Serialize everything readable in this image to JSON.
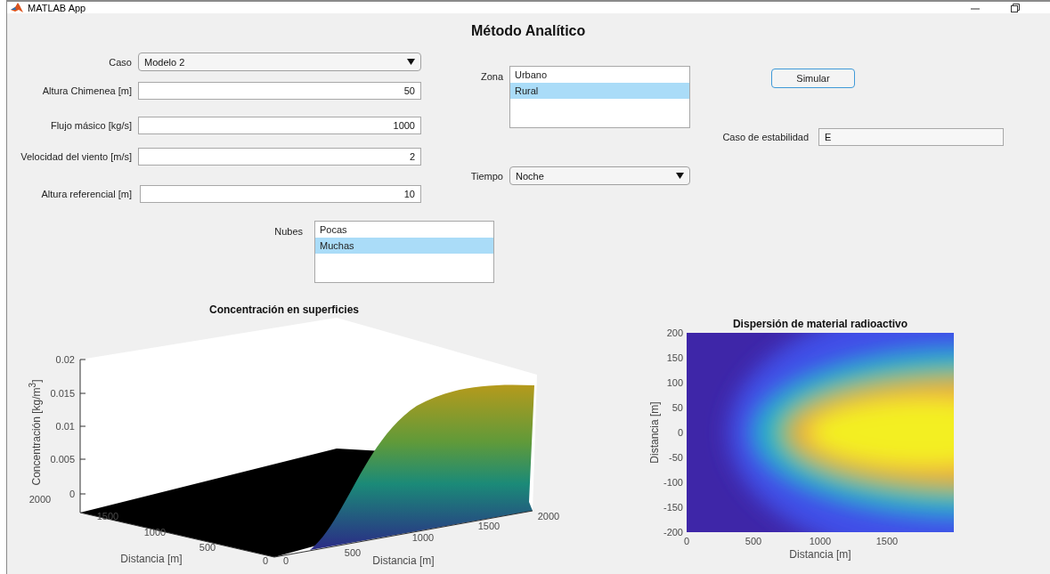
{
  "window": {
    "title": "MATLAB App"
  },
  "heading": "Método Analítico",
  "fields": [
    {
      "kind": "dropdown",
      "label": "Caso",
      "value": "Modelo 2"
    },
    {
      "kind": "number",
      "label": "Altura Chimenea [m]",
      "value": "50"
    },
    {
      "kind": "number",
      "label": "Flujo másico [kg/s]",
      "value": "1000"
    },
    {
      "kind": "number",
      "label": "Velocidad del viento [m/s]",
      "value": "2"
    },
    {
      "kind": "number",
      "label": "Altura referencial [m]",
      "value": "10"
    }
  ],
  "zona": {
    "label": "Zona",
    "items": [
      {
        "label": "Urbano",
        "selected": false
      },
      {
        "label": "Rural",
        "selected": true
      }
    ]
  },
  "tiempo": {
    "label": "Tiempo",
    "value": "Noche"
  },
  "nubes": {
    "label": "Nubes",
    "items": [
      {
        "label": "Pocas",
        "selected": false
      },
      {
        "label": "Muchas",
        "selected": true
      }
    ]
  },
  "simulate_button": "Simular",
  "estabilidad": {
    "label": "Caso de estabilidad",
    "value": "E"
  },
  "surface_plot": {
    "title": "Concentración en superficies",
    "zlabel": "Concentración  [kg/m$^{3}$]",
    "zticks": [
      "0.02",
      "0.015",
      "0.01",
      "0.005",
      "0"
    ],
    "left_axis": {
      "label": "Distancia [m]",
      "ticks": [
        "2000",
        "1500",
        "1000",
        "500",
        "0"
      ]
    },
    "right_axis": {
      "label": "Distancia [m]",
      "ticks": [
        "0",
        "500",
        "1000",
        "1500",
        "2000"
      ]
    }
  },
  "heatmap": {
    "title": "Dispersión de material radioactivo",
    "xlabel": "Distancia [m]",
    "ylabel": "Distancia [m]",
    "xticks": [
      "0",
      "500",
      "1000",
      "1500"
    ],
    "yticks": [
      "200",
      "150",
      "100",
      "50",
      "0",
      "-50",
      "-100",
      "-150",
      "-200"
    ]
  }
}
